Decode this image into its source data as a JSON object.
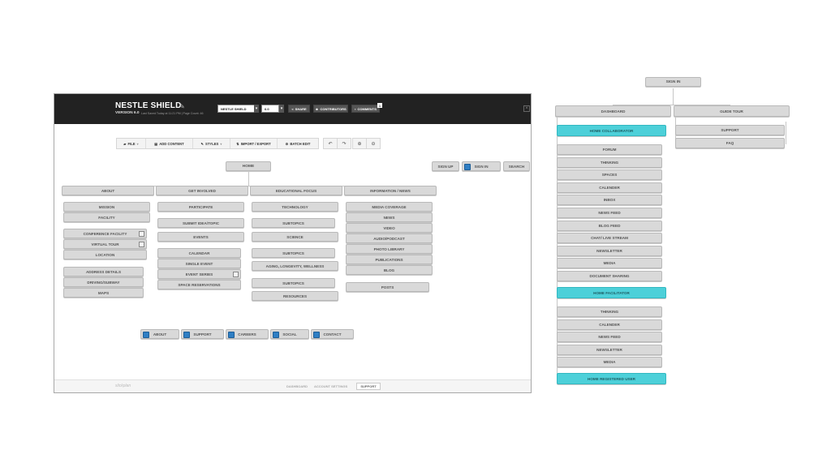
{
  "app": {
    "title": "NESTLE SHIELD",
    "version": "VERSION 6.0",
    "saved_info": "Last Saved Today at 11:21 PM  |  Page Count: 46",
    "project_select": "NESTLE SHIELD",
    "version_select": "6.0",
    "share_label": "SHARE",
    "contributors_label": "CONTRIBUTORS",
    "comments_label": "COMMENTS",
    "comments_count": "1"
  },
  "toolbar": {
    "file": "FILE",
    "add_content": "ADD CONTENT",
    "styles": "STYLES",
    "import_export": "IMPORT / EXPORT",
    "batch_edit": "BATCH EDIT"
  },
  "sitemap": {
    "home": "HOME",
    "top_right": [
      "SIGN UP",
      "SIGN IN",
      "SEARCH"
    ],
    "about": {
      "label": "ABOUT",
      "items": [
        "MISSION",
        "FACILITY",
        "CONFERENCE FACILITY",
        "VIRTUAL TOUR",
        "LOCATION",
        "ADDRESS DETAILS",
        "DRIVING/SUBWAY",
        "MAPS"
      ]
    },
    "get_involved": {
      "label": "GET INVOLVED",
      "items": [
        "PARTICIPATE",
        "SUBMIT IDEA/TOPIC",
        "EVENTS",
        "CALENDAR",
        "SINGLE EVENT",
        "EVENT SERIES",
        "SPACE RESERVATIONS"
      ]
    },
    "educational_focus": {
      "label": "EDUCATIONAL FOCUS",
      "items": [
        "TECHNOLOGY",
        "SUBTOPICS",
        "SCIENCE",
        "SUBTOPICS",
        "AGING, LONGEVITY, WELLNESS",
        "SUBTOPICS",
        "RESOURCES"
      ]
    },
    "information_news": {
      "label": "INFORMATION / NEWS",
      "items": [
        "MEDIA COVERAGE",
        "NEWS",
        "VIDEO",
        "AUDIO/PODCAST",
        "PHOTO LIBRARY",
        "PUBLICATIONS",
        "BLOG",
        "POSTS"
      ]
    },
    "footer_nav": [
      "ABOUT",
      "SUPPORT",
      "CAREERS",
      "SOCIAL",
      "CONTACT"
    ]
  },
  "footer": {
    "brand": "slickplan",
    "links": [
      "DASHBOARD",
      "ACCOUNT SETTINGS"
    ],
    "support": "SUPPORT"
  },
  "right_map": {
    "sign_in": "SIGN IN",
    "dashboard": "DASHBOARD",
    "guide_tour": "GUIDE TOUR",
    "guide_items": [
      "SUPPORT",
      "FAQ"
    ],
    "home_collaborator": "HOME COLLABORATOR",
    "collaborator_items": [
      "FORUM",
      "THINKING",
      "SPACES",
      "CALENDER",
      "INBOX",
      "NEWS FEED",
      "BLOG FEED",
      "CHAT/ LIVE STREAM",
      "NEWSLETTER",
      "MEDIA",
      "DOCUMENT SHARING"
    ],
    "home_facilitator": "HOME FACILITATOR",
    "facilitator_items": [
      "THINKING",
      "CALENDER",
      "NEWS FEED",
      "NEWSLETTER",
      "MEDIA"
    ],
    "home_registered": "HOME REGISTERED USER"
  },
  "colors": {
    "highlight": "#4dd0d9",
    "topbar": "#222222",
    "node": "#d9d9d9"
  }
}
